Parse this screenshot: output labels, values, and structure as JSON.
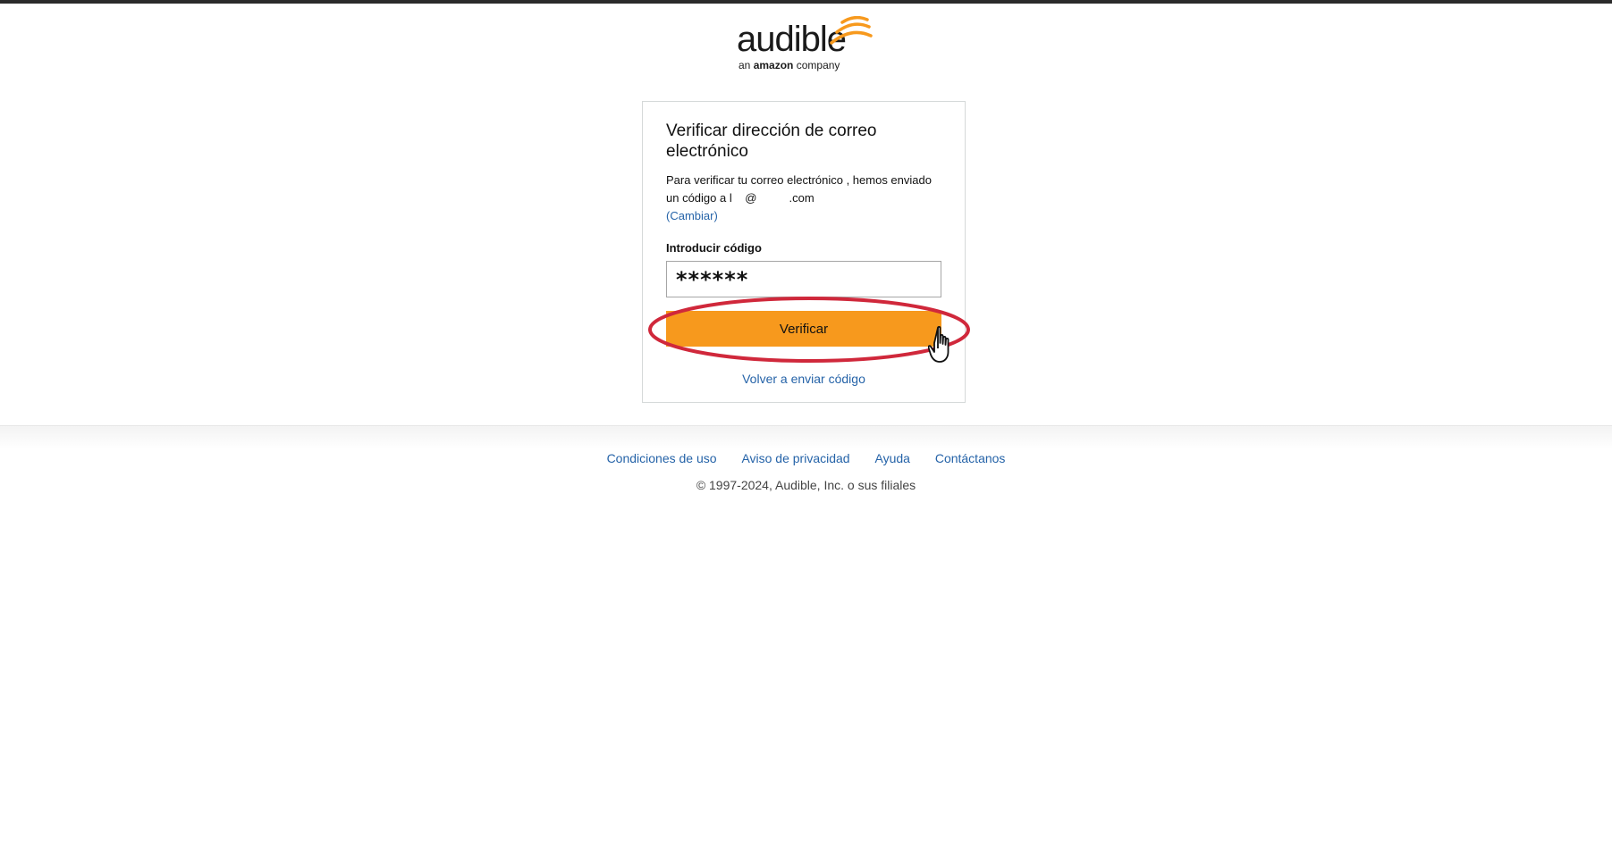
{
  "logo": {
    "word": "audible",
    "tag_prefix": "an",
    "tag_brand": "amazon",
    "tag_suffix": "company"
  },
  "card": {
    "title": "Verificar dirección de correo electrónico",
    "desc_prefix": "Para verificar tu correo electrónico , hemos enviado un código a",
    "email": "l    @          .com",
    "change_label": "(Cambiar)",
    "field_label": "Introducir código",
    "code_value": "******",
    "verify_label": "Verificar",
    "resend_label": "Volver a enviar código"
  },
  "colors": {
    "button": "#f7991d",
    "link": "#2563a8",
    "annotation": "#d0283b"
  },
  "footer": {
    "links": [
      "Condiciones de uso",
      "Aviso de privacidad",
      "Ayuda",
      "Contáctanos"
    ],
    "copyright": "© 1997-2024, Audible, Inc. o sus filiales"
  }
}
